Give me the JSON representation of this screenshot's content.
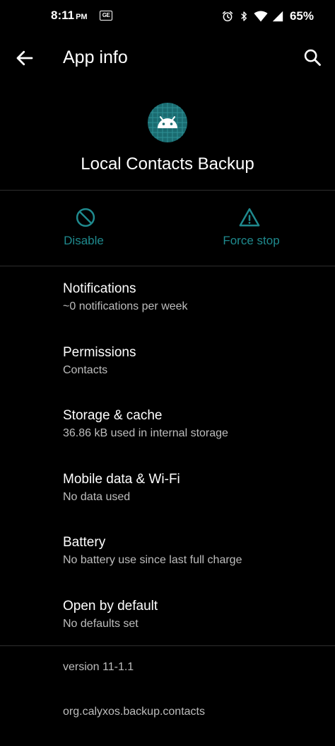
{
  "status_bar": {
    "time": "8:11",
    "ampm": "PM",
    "notification_badge": "GE",
    "battery": "65%"
  },
  "app_bar": {
    "title": "App info"
  },
  "app": {
    "name": "Local Contacts Backup",
    "icon": "android-icon"
  },
  "actions": {
    "disable": {
      "label": "Disable",
      "icon": "disable-icon"
    },
    "force_stop": {
      "label": "Force stop",
      "icon": "warning-triangle-icon"
    }
  },
  "items": [
    {
      "title": "Notifications",
      "summary": "~0 notifications per week"
    },
    {
      "title": "Permissions",
      "summary": "Contacts"
    },
    {
      "title": "Storage & cache",
      "summary": "36.86 kB used in internal storage"
    },
    {
      "title": "Mobile data & Wi-Fi",
      "summary": "No data used"
    },
    {
      "title": "Battery",
      "summary": "No battery use since last full charge"
    },
    {
      "title": "Open by default",
      "summary": "No defaults set"
    }
  ],
  "footer": {
    "version": "version 11-1.1",
    "package": "org.calyxos.backup.contacts"
  },
  "colors": {
    "background": "#000000",
    "accent": "#1f8a8e",
    "icon_teal": "#1a6b70",
    "secondary_text": "#bdbdbd"
  }
}
